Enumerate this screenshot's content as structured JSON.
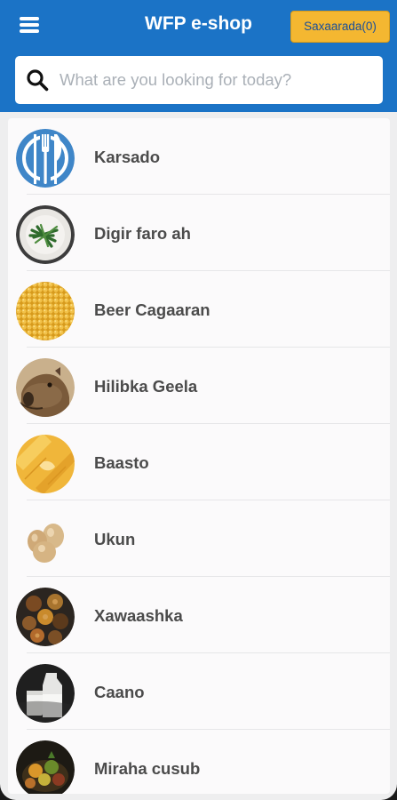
{
  "header": {
    "title": "WFP e-shop",
    "cart_label": "Saxaarada(0)",
    "menu_icon": "hamburger-menu-icon"
  },
  "search": {
    "placeholder": "What are you looking for today?",
    "value": "",
    "icon": "search-icon"
  },
  "categories": [
    {
      "label": "Karsado",
      "icon": "cutlery-icon"
    },
    {
      "label": "Digir faro ah",
      "icon": "green-beans-image"
    },
    {
      "label": "Beer Cagaaran",
      "icon": "corn-image"
    },
    {
      "label": "Hilibka Geela",
      "icon": "camel-image"
    },
    {
      "label": "Baasto",
      "icon": "pasta-image"
    },
    {
      "label": "Ukun",
      "icon": "eggs-image"
    },
    {
      "label": "Xawaashka",
      "icon": "spices-image"
    },
    {
      "label": "Caano",
      "icon": "milk-image"
    },
    {
      "label": "Miraha cusub",
      "icon": "fresh-fruit-image"
    }
  ],
  "colors": {
    "header_bg": "#1b73c6",
    "cart_bg": "#f4b731",
    "cart_text": "#1a4f9a",
    "item_text": "#4b4b4b"
  }
}
